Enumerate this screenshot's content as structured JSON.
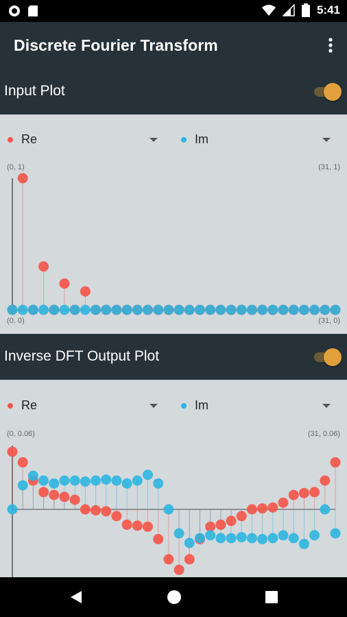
{
  "status_bar": {
    "time": "5:41",
    "left_icons": [
      "record-icon",
      "sd-card-icon"
    ],
    "right_icons": [
      "wifi-icon",
      "signal-icon",
      "battery-icon"
    ]
  },
  "app_bar": {
    "title": "Discrete Fourier Transform",
    "menu_icon": "overflow-menu-icon"
  },
  "sections": [
    {
      "title": "Input Plot",
      "toggle_on": true,
      "legend": [
        {
          "label": "Re",
          "color": "#f4574a"
        },
        {
          "label": "Im",
          "color": "#2db5e0"
        }
      ],
      "corners": {
        "top_left": "(0, 1)",
        "top_right": "(31, 1)",
        "bottom_left": "(0, 0)",
        "bottom_right": "(31, 0)"
      }
    },
    {
      "title": "Inverse DFT Output Plot",
      "toggle_on": true,
      "legend": [
        {
          "label": "Re",
          "color": "#f4574a"
        },
        {
          "label": "Im",
          "color": "#2db5e0"
        }
      ],
      "corners": {
        "top_left": "(0, 0.06)",
        "top_right": "(31, 0.06)"
      }
    }
  ],
  "colors": {
    "accent": "#e2a03c",
    "re": "#f4574a",
    "im": "#2db5e0",
    "header": "#263238",
    "plot_bg": "#d4d9dc"
  },
  "chart_data": [
    {
      "type": "scatter",
      "title": "Input Plot",
      "x": [
        0,
        1,
        2,
        3,
        4,
        5,
        6,
        7,
        8,
        9,
        10,
        11,
        12,
        13,
        14,
        15,
        16,
        17,
        18,
        19,
        20,
        21,
        22,
        23,
        24,
        25,
        26,
        27,
        28,
        29,
        30,
        31
      ],
      "xlim": [
        0,
        31
      ],
      "ylim": [
        0,
        1
      ],
      "series": [
        {
          "name": "Re",
          "values": [
            0,
            1,
            0,
            0.33,
            0,
            0.2,
            0,
            0.14,
            0,
            0,
            0,
            0,
            0,
            0,
            0,
            0,
            0,
            0,
            0,
            0,
            0,
            0,
            0,
            0,
            0,
            0,
            0,
            0,
            0,
            0,
            0,
            0
          ]
        },
        {
          "name": "Im",
          "values": [
            0,
            0,
            0,
            0,
            0,
            0,
            0,
            0,
            0,
            0,
            0,
            0,
            0,
            0,
            0,
            0,
            0,
            0,
            0,
            0,
            0,
            0,
            0,
            0,
            0,
            0,
            0,
            0,
            0,
            0,
            0,
            0
          ]
        }
      ]
    },
    {
      "type": "scatter",
      "title": "Inverse DFT Output Plot",
      "x": [
        0,
        1,
        2,
        3,
        4,
        5,
        6,
        7,
        8,
        9,
        10,
        11,
        12,
        13,
        14,
        15,
        16,
        17,
        18,
        19,
        20,
        21,
        22,
        23,
        24,
        25,
        26,
        27,
        28,
        29,
        30,
        31
      ],
      "xlim": [
        0,
        31
      ],
      "ylim": [
        -0.06,
        0.06
      ],
      "series": [
        {
          "name": "Re",
          "values": [
            0.06,
            0.049,
            0.03,
            0.018,
            0.015,
            0.013,
            0.01,
            0.0,
            -0.001,
            -0.002,
            -0.007,
            -0.016,
            -0.017,
            -0.018,
            -0.031,
            -0.052,
            -0.063,
            -0.052,
            -0.031,
            -0.018,
            -0.016,
            -0.012,
            -0.007,
            0.0,
            0.001,
            0.002,
            0.007,
            0.015,
            0.017,
            0.018,
            0.03,
            0.049
          ]
        },
        {
          "name": "Im",
          "values": [
            0.0,
            0.025,
            0.035,
            0.03,
            0.027,
            0.03,
            0.03,
            0.029,
            0.03,
            0.031,
            0.03,
            0.027,
            0.03,
            0.036,
            0.027,
            0.0,
            -0.025,
            -0.035,
            -0.03,
            -0.027,
            -0.03,
            -0.03,
            -0.029,
            -0.03,
            -0.031,
            -0.03,
            -0.027,
            -0.03,
            -0.036,
            -0.027,
            0.0,
            -0.025
          ]
        }
      ]
    }
  ]
}
